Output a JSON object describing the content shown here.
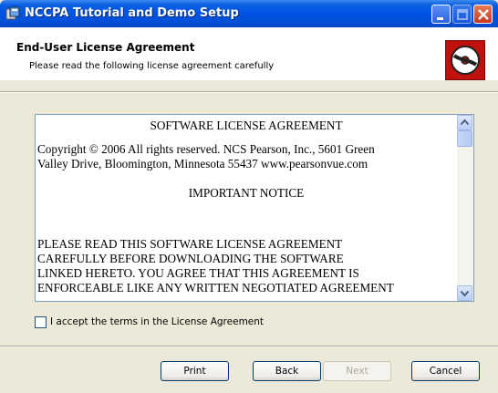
{
  "window": {
    "title": "NCCPA Tutorial and Demo Setup"
  },
  "icons": {
    "app": "installer-app-icon",
    "logo": "disc-logo-icon",
    "minimize": "minimize-icon",
    "maximize": "maximize-icon",
    "close": "close-icon",
    "scroll_up": "chevron-up-icon",
    "scroll_down": "chevron-down-icon"
  },
  "header": {
    "title": "End-User License Agreement",
    "subtitle": "Please read the following license agreement carefully"
  },
  "license": {
    "heading": "SOFTWARE LICENSE AGREEMENT",
    "copyright_line1": "Copyright © 2006 All rights reserved. NCS Pearson, Inc., 5601 Green",
    "copyright_line2": "Valley Drive, Bloomington, Minnesota 55437 www.pearsonvue.com",
    "notice_heading": "IMPORTANT NOTICE",
    "notice_line1": "PLEASE READ THIS SOFTWARE LICENSE AGREEMENT",
    "notice_line2": "CAREFULLY BEFORE DOWNLOADING THE SOFTWARE",
    "notice_line3": "LINKED HERETO.  YOU AGREE THAT THIS AGREEMENT IS",
    "notice_line4": "ENFORCEABLE LIKE ANY WRITTEN NEGOTIATED AGREEMENT"
  },
  "accept": {
    "label": "I accept the terms in the License Agreement",
    "checked": false
  },
  "buttons": {
    "print": "Print",
    "back": "Back",
    "next": "Next",
    "cancel": "Cancel"
  },
  "colors": {
    "titlebar": "#0054e3",
    "logo_bg": "#c0120c",
    "dialog_bg": "#ece9d8"
  }
}
